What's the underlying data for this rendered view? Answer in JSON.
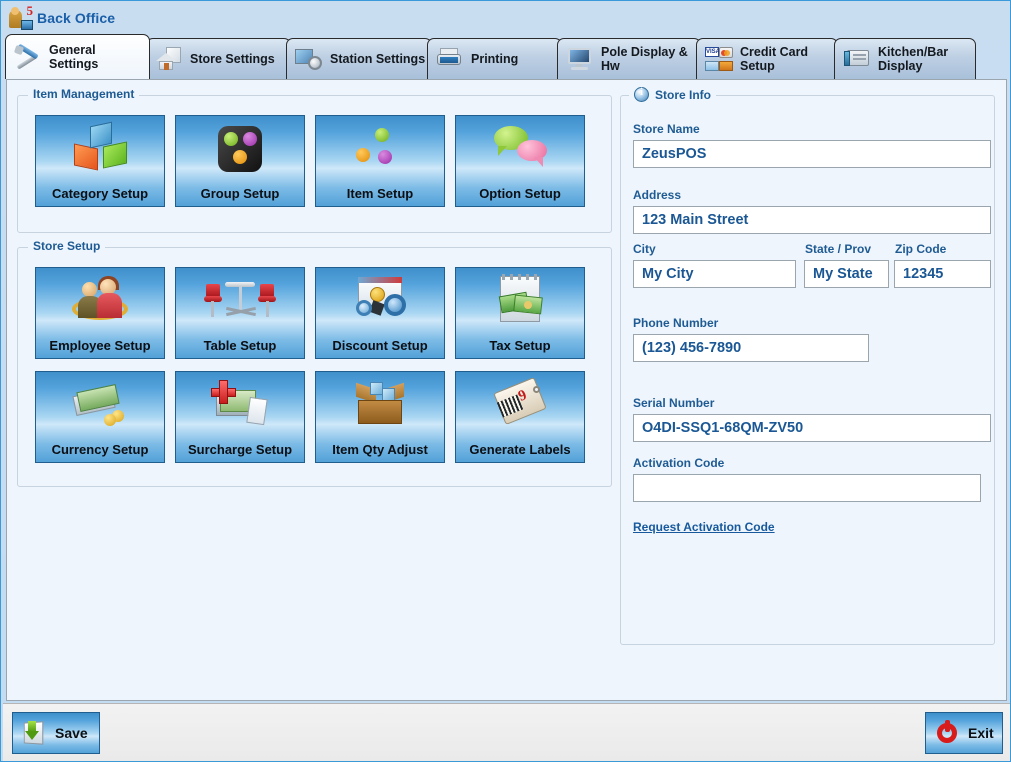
{
  "window": {
    "title": "Back Office",
    "title_icon": "cashier-icon"
  },
  "tabs": [
    {
      "label": "General\nSettings",
      "icon": "wrench-screwdriver-icon",
      "active": true
    },
    {
      "label": "Store Settings",
      "icon": "house-icon",
      "active": false
    },
    {
      "label": "Station Settings",
      "icon": "monitor-gear-icon",
      "active": false
    },
    {
      "label": "Printing",
      "icon": "printer-icon",
      "active": false
    },
    {
      "label": "Pole Display &\nHw",
      "icon": "pole-display-icon",
      "active": false
    },
    {
      "label": "Credit Card\nSetup",
      "icon": "credit-cards-icon",
      "active": false
    },
    {
      "label": "Kitchen/Bar\nDisplay",
      "icon": "kitchen-display-icon",
      "active": false
    }
  ],
  "item_management": {
    "title": "Item Management",
    "buttons": [
      {
        "label": "Category Setup",
        "icon": "colored-cubes-icon"
      },
      {
        "label": "Group Setup",
        "icon": "dark-pad-dots-icon"
      },
      {
        "label": "Item Setup",
        "icon": "three-dots-icon"
      },
      {
        "label": "Option Setup",
        "icon": "speech-bubbles-icon"
      }
    ]
  },
  "store_setup": {
    "title": "Store Setup",
    "buttons": [
      {
        "label": "Employee Setup",
        "icon": "two-people-icon"
      },
      {
        "label": "Table Setup",
        "icon": "table-chairs-icon"
      },
      {
        "label": "Discount Setup",
        "icon": "window-gears-coin-icon"
      },
      {
        "label": "Tax Setup",
        "icon": "notepad-money-icon"
      },
      {
        "label": "Currency Setup",
        "icon": "bills-coins-icon"
      },
      {
        "label": "Surcharge Setup",
        "icon": "plus-money-receipt-icon"
      },
      {
        "label": "Item Qty Adjust",
        "icon": "open-box-icon"
      },
      {
        "label": "Generate Labels",
        "icon": "price-tag-icon"
      }
    ]
  },
  "store_info": {
    "title": "Store Info",
    "icon": "info-icon",
    "fields": {
      "store_name": {
        "label": "Store Name",
        "value": "ZeusPOS",
        "placeholder": ""
      },
      "address": {
        "label": "Address",
        "value": "123 Main Street",
        "placeholder": ""
      },
      "city": {
        "label": "City",
        "value": "My City",
        "placeholder": ""
      },
      "state": {
        "label": "State / Prov",
        "value": "My State",
        "placeholder": ""
      },
      "zip": {
        "label": "Zip Code",
        "value": "12345",
        "placeholder": ""
      },
      "phone": {
        "label": "Phone Number",
        "value": "(123) 456-7890",
        "placeholder": ""
      },
      "serial": {
        "label": "Serial Number",
        "value": "O4DI-SSQ1-68QM-ZV50",
        "placeholder": ""
      },
      "activation": {
        "label": "Activation Code",
        "value": "",
        "placeholder": ""
      }
    },
    "request_link": "Request Activation Code"
  },
  "footer": {
    "save_label": "Save",
    "save_icon": "save-disk-icon",
    "exit_label": "Exit",
    "exit_icon": "power-off-icon"
  },
  "colors": {
    "window_bg": "#c3ddf2",
    "content_bg": "#eef5fd",
    "accent_blue": "#1f5b93",
    "tile_blue": "#54a3dc",
    "link_blue": "#17599c",
    "border_blue": "#3a9ad9"
  }
}
